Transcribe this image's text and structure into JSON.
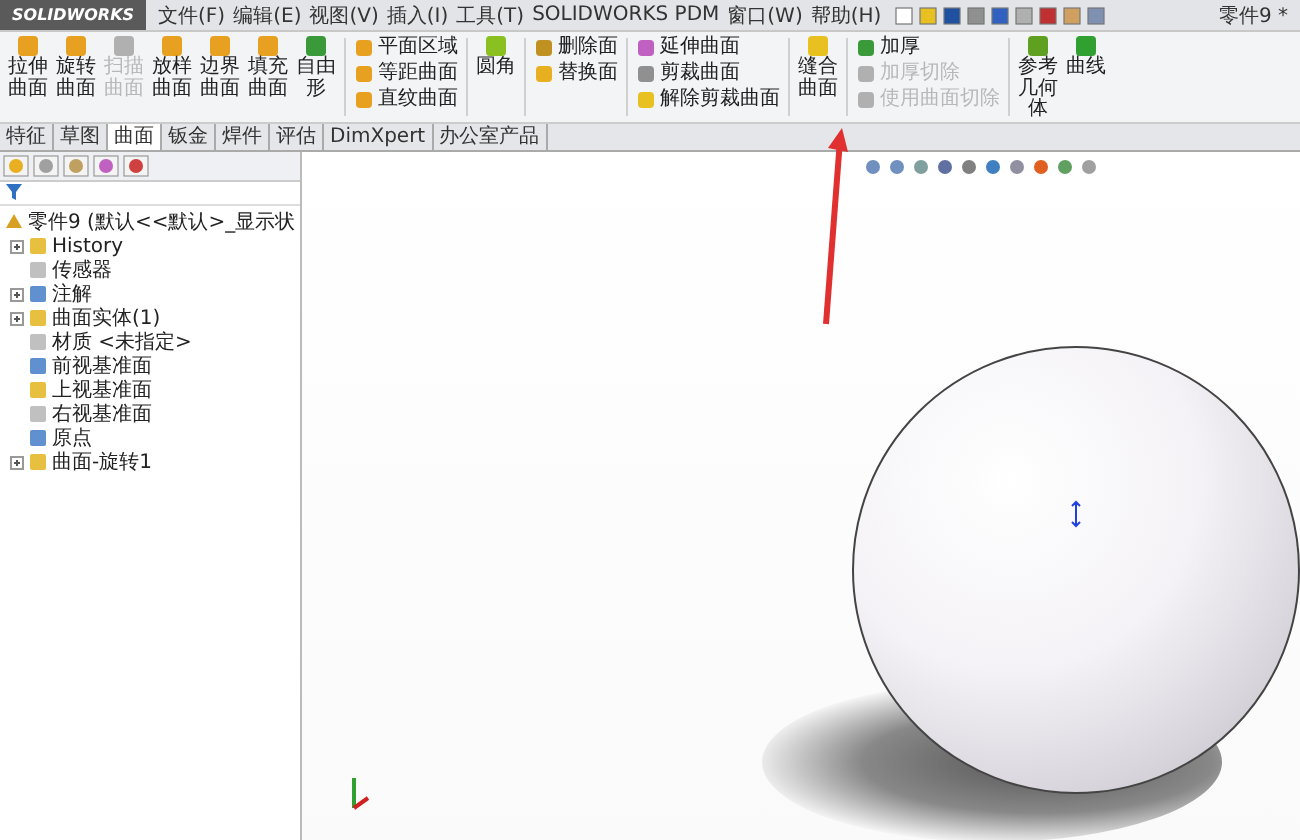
{
  "title_bar": {
    "logo": "SOLIDWORKS",
    "menu": [
      "文件(F)",
      "编辑(E)",
      "视图(V)",
      "插入(I)",
      "工具(T)",
      "SOLIDWORKS PDM",
      "窗口(W)",
      "帮助(H)"
    ],
    "document_title": "零件9 *"
  },
  "ribbon": [
    {
      "kind": "large",
      "items": [
        {
          "label": "拉伸曲面",
          "disabled": false,
          "color": "#e8a020"
        },
        {
          "label": "旋转曲面",
          "disabled": false,
          "color": "#e8a020"
        },
        {
          "label": "扫描曲面",
          "disabled": true,
          "color": "#b0b0b0"
        },
        {
          "label": "放样曲面",
          "disabled": false,
          "color": "#e8a020"
        },
        {
          "label": "边界曲面",
          "disabled": false,
          "color": "#e8a020"
        },
        {
          "label": "填充曲面",
          "disabled": false,
          "color": "#e8a020"
        },
        {
          "label": "自由形",
          "disabled": false,
          "color": "#3a9a3a"
        }
      ]
    },
    {
      "kind": "column",
      "items": [
        {
          "label": "平面区域",
          "disabled": false,
          "color": "#e8a020"
        },
        {
          "label": "等距曲面",
          "disabled": false,
          "color": "#e8a020"
        },
        {
          "label": "直纹曲面",
          "disabled": false,
          "color": "#e8a020"
        }
      ]
    },
    {
      "kind": "large",
      "items": [
        {
          "label": "圆角",
          "disabled": false,
          "color": "#8ac020"
        }
      ]
    },
    {
      "kind": "column",
      "items": [
        {
          "label": "删除面",
          "disabled": false,
          "color": "#c09020"
        },
        {
          "label": "替换面",
          "disabled": false,
          "color": "#e8b020"
        }
      ]
    },
    {
      "kind": "column",
      "items": [
        {
          "label": "延伸曲面",
          "disabled": false,
          "color": "#c060c0"
        },
        {
          "label": "剪裁曲面",
          "disabled": false,
          "color": "#909090"
        },
        {
          "label": "解除剪裁曲面",
          "disabled": false,
          "color": "#e8c020"
        }
      ]
    },
    {
      "kind": "large",
      "items": [
        {
          "label": "缝合曲面",
          "disabled": false,
          "color": "#e8c020"
        }
      ]
    },
    {
      "kind": "column",
      "items": [
        {
          "label": "加厚",
          "disabled": false,
          "color": "#3a9a3a"
        },
        {
          "label": "加厚切除",
          "disabled": true,
          "color": "#b0b0b0"
        },
        {
          "label": "使用曲面切除",
          "disabled": true,
          "color": "#b0b0b0"
        }
      ]
    },
    {
      "kind": "large",
      "items": [
        {
          "label": "参考几何体",
          "disabled": false,
          "color": "#60a020"
        },
        {
          "label": "曲线",
          "disabled": false,
          "color": "#30a030"
        }
      ]
    }
  ],
  "tabs": [
    {
      "label": "特征",
      "selected": false
    },
    {
      "label": "草图",
      "selected": false
    },
    {
      "label": "曲面",
      "selected": true
    },
    {
      "label": "钣金",
      "selected": false
    },
    {
      "label": "焊件",
      "selected": false
    },
    {
      "label": "评估",
      "selected": false
    },
    {
      "label": "DimXpert",
      "selected": false
    },
    {
      "label": "办公室产品",
      "selected": false
    }
  ],
  "feature_tree": {
    "root": {
      "label": "零件9 (默认<<默认>_显示状",
      "children": [
        {
          "label": "History",
          "expandable": true
        },
        {
          "label": "传感器",
          "expandable": false
        },
        {
          "label": "注解",
          "expandable": true
        },
        {
          "label": "曲面实体(1)",
          "expandable": true
        },
        {
          "label": "材质 <未指定>",
          "expandable": false
        },
        {
          "label": "前视基准面",
          "expandable": false
        },
        {
          "label": "上视基准面",
          "expandable": false
        },
        {
          "label": "右视基准面",
          "expandable": false
        },
        {
          "label": "原点",
          "expandable": false
        },
        {
          "label": "曲面-旋转1",
          "expandable": true
        }
      ]
    }
  }
}
